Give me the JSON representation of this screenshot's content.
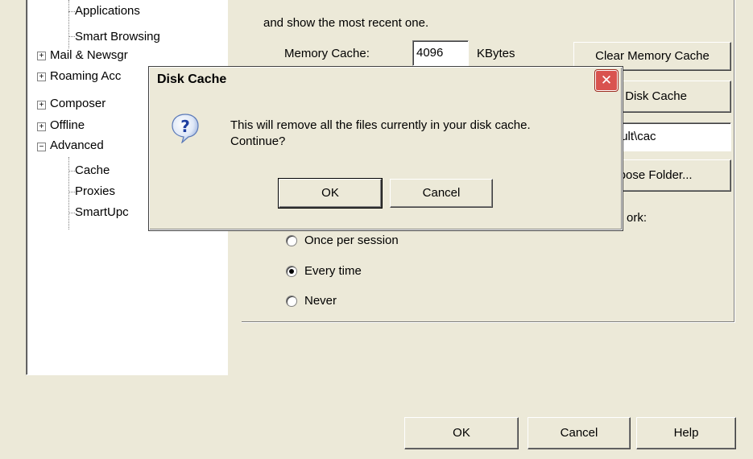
{
  "tree": {
    "items": [
      {
        "label": "Applications"
      },
      {
        "label": "Smart Browsing"
      },
      {
        "label": "Mail & Newsgr"
      },
      {
        "label": "Roaming Acc"
      },
      {
        "label": "Composer"
      },
      {
        "label": "Offline"
      },
      {
        "label": "Advanced"
      },
      {
        "label": "Cache"
      },
      {
        "label": "Proxies"
      },
      {
        "label": "SmartUpc"
      }
    ]
  },
  "cache_panel": {
    "description_line": "and show the most recent one.",
    "memory_cache_label": "Memory Cache:",
    "memory_cache_value": "4096",
    "memory_cache_unit": "KBytes",
    "clear_memory_button": "Clear Memory Cache",
    "clear_disk_button": "r Disk Cache",
    "folder_path": "ers\\default\\cac",
    "choose_folder_button": "hoose Folder...",
    "compare_label_tail": "ork:",
    "radio_options": [
      {
        "label": "Once per session",
        "selected": false
      },
      {
        "label": "Every time",
        "selected": true
      },
      {
        "label": "Never",
        "selected": false
      }
    ]
  },
  "footer": {
    "ok": "OK",
    "cancel": "Cancel",
    "help": "Help"
  },
  "dialog": {
    "title": "Disk Cache",
    "close_glyph": "✕",
    "message_line1": "This will remove all the files currently in your disk cache.",
    "message_line2": "Continue?",
    "ok": "OK",
    "cancel": "Cancel",
    "icon": "question-icon"
  }
}
